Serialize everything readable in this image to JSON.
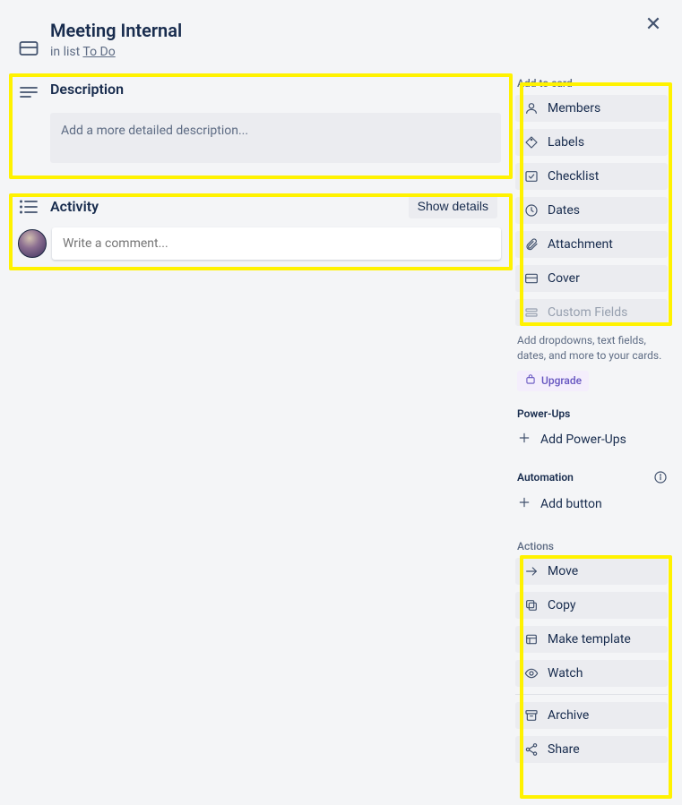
{
  "header": {
    "title": "Meeting Internal",
    "in_list_prefix": "in list ",
    "list_name": "To Do"
  },
  "close_label": "✕",
  "description": {
    "heading": "Description",
    "placeholder": "Add a more detailed description..."
  },
  "activity": {
    "heading": "Activity",
    "show_details": "Show details",
    "comment_placeholder": "Write a comment..."
  },
  "sidebar": {
    "add_to_card_heading": "Add to card",
    "items": [
      {
        "label": "Members"
      },
      {
        "label": "Labels"
      },
      {
        "label": "Checklist"
      },
      {
        "label": "Dates"
      },
      {
        "label": "Attachment"
      },
      {
        "label": "Cover"
      },
      {
        "label": "Custom Fields"
      }
    ],
    "custom_fields_hint": "Add dropdowns, text fields, dates, and more to your cards.",
    "upgrade_label": "Upgrade",
    "powerups_heading": "Power-Ups",
    "add_powerups": "Add Power-Ups",
    "automation_heading": "Automation",
    "add_button": "Add button",
    "actions_heading": "Actions",
    "actions": [
      {
        "label": "Move"
      },
      {
        "label": "Copy"
      },
      {
        "label": "Make template"
      },
      {
        "label": "Watch"
      },
      {
        "label": "Archive"
      },
      {
        "label": "Share"
      }
    ]
  }
}
